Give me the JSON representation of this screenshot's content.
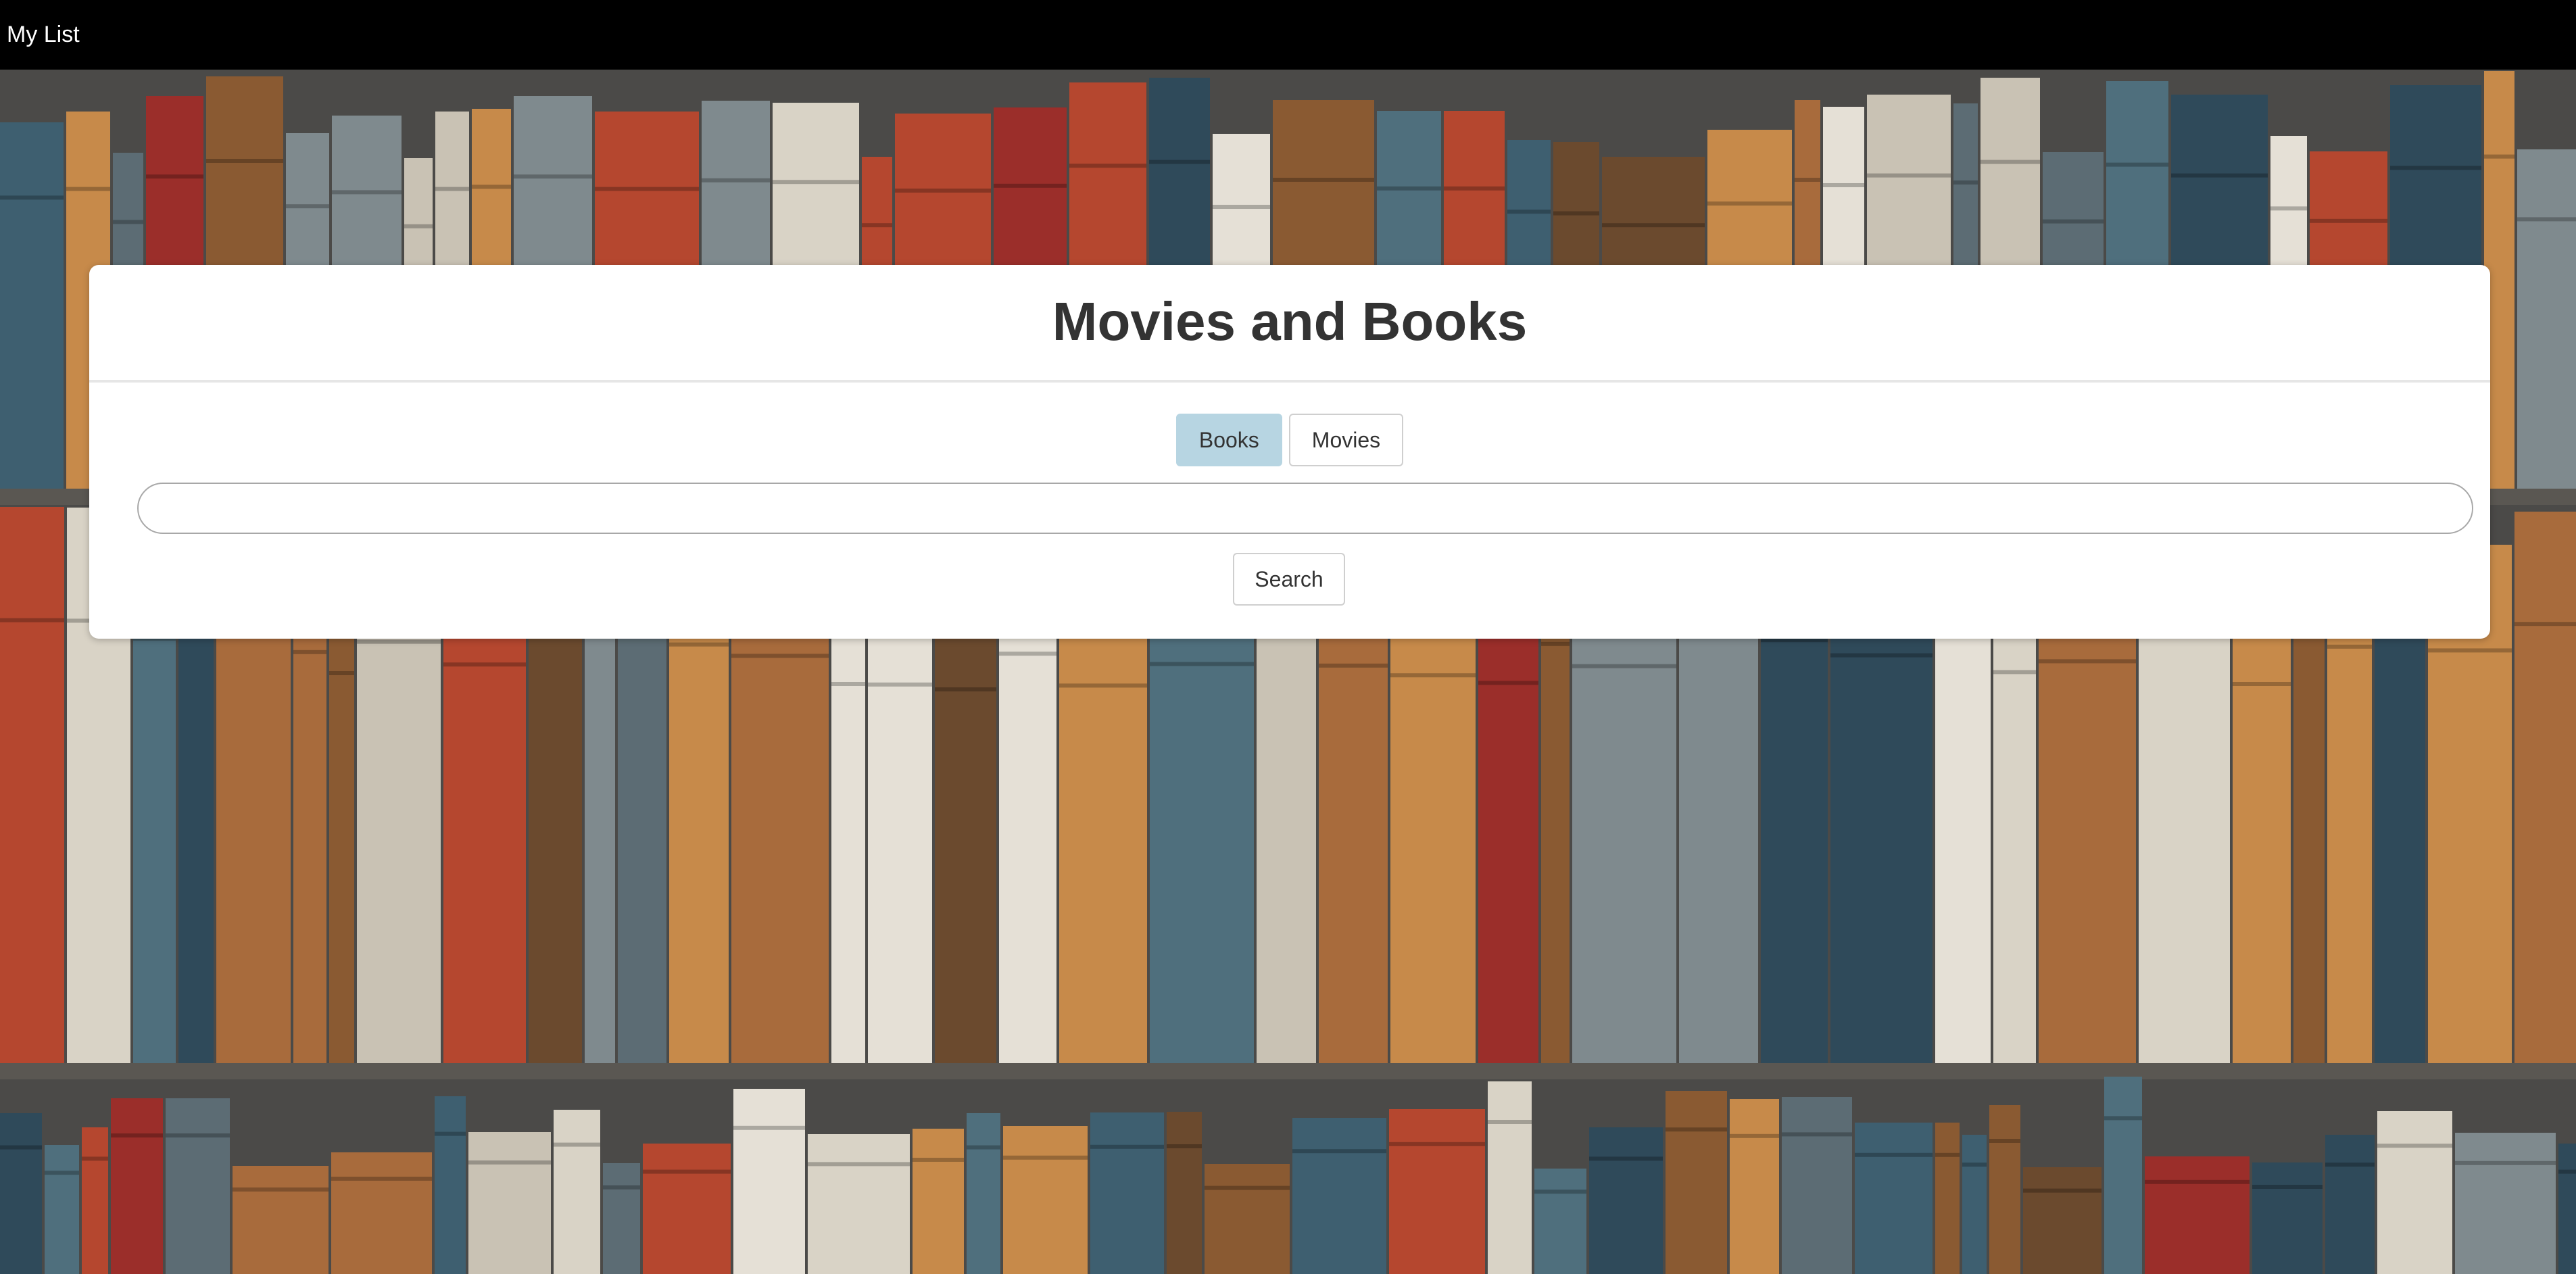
{
  "navbar": {
    "brand_label": "My List"
  },
  "card": {
    "title": "Movies and Books",
    "tabs": [
      {
        "label": "Books",
        "active": true
      },
      {
        "label": "Movies",
        "active": false
      }
    ],
    "search": {
      "value": "",
      "placeholder": ""
    },
    "search_button_label": "Search"
  },
  "colors": {
    "navbar_bg": "#000000",
    "active_tab": "#b7d5e2",
    "card_bg": "#ffffff",
    "title_text": "#333333"
  },
  "background": {
    "image": "bookshelf-image"
  }
}
